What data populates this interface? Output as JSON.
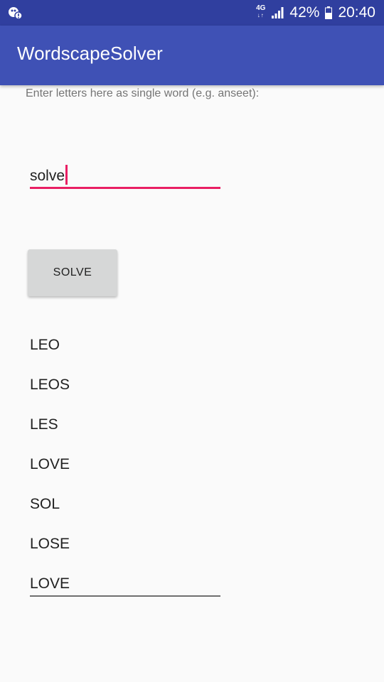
{
  "status_bar": {
    "network_type": "4G",
    "battery_percent": "42%",
    "time": "20:40",
    "icons": [
      "notification-icon",
      "signal-icon",
      "battery-icon"
    ]
  },
  "app_bar": {
    "title": "WordscapeSolver"
  },
  "form": {
    "hint": "Enter letters here as single word (e.g. anseet):",
    "input_value": "solve",
    "button_label": "SOLVE"
  },
  "results": [
    "LEO",
    "LEOS",
    "LES",
    "LOVE",
    "SOL",
    "LOSE",
    "LOVE"
  ],
  "colors": {
    "status_bar": "#303f9f",
    "app_bar": "#3f51b5",
    "accent": "#e91e63",
    "background": "#fafafa",
    "button": "#d6d7d7"
  }
}
